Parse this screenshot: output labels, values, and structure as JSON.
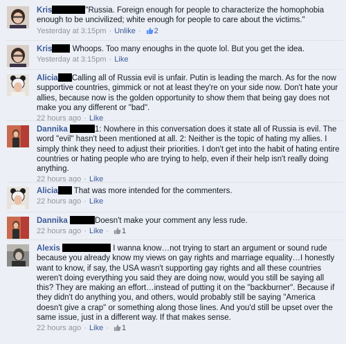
{
  "comments": [
    {
      "name": "Kris",
      "text": "\"Russia. Foreign enough for people to characterize the homophobia enough to be uncivilized; white enough for people to care about the victims.\"",
      "time": "Yesterday at 3:15pm",
      "action": "Unlike",
      "likes": "2",
      "avatar": "kris-avatar-icon"
    },
    {
      "name": "Kris",
      "text": "Whoops. Too many enoughs in the quote lol. But you get the idea.",
      "time": "Yesterday at 3:15pm",
      "action": "Like",
      "likes": "",
      "avatar": "kris-avatar-icon"
    },
    {
      "name": "Alicia",
      "text": "Calling all of Russia evil is unfair. Putin is leading the march. As for the now supportive countries, gimmick or not at least they're on your side now. Don't hate your allies, because now is the golden opportunity to show them that being gay does not make you any different or \"bad\".",
      "time": "22 hours ago",
      "action": "Like",
      "likes": "",
      "avatar": "alicia-avatar-icon"
    },
    {
      "name": "Dannika",
      "text": "1: Nowhere in this conversation does it state all of Russia is evil. The word \"evil\" hasn't been mentioned at all. 2: Neither is the topic of hating my allies. I simply think they need to adjust their priorities. I don't get into the habit of hating entire countries or hating people who are trying to help, even if their help isn't really doing anything.",
      "time": "22 hours ago",
      "action": "Like",
      "likes": "",
      "avatar": "dannika-avatar-icon"
    },
    {
      "name": "Alicia",
      "text": "That was more intended for the commenters.",
      "time": "22 hours ago",
      "action": "Like",
      "likes": "",
      "avatar": "alicia-avatar-icon"
    },
    {
      "name": "Dannika",
      "text": "Doesn't make your comment any less rude.",
      "time": "22 hours ago",
      "action": "Like",
      "likes": "1",
      "avatar": "dannika-avatar-icon"
    },
    {
      "name": "Alexis",
      "text": "I wanna know…not trying to start an argument or sound rude because you already know my views on gay rights and marriage equality…I honestly want to know, if say, the USA wasn't supporting gay rights and all these countries weren't doing everything you said they are doing now, would you still be saying all this? They are making an effort…instead of putting it on the \"backburner\". Because if they didn't do anything you, and others, would probably still be saying \"America doesn't give a crap\" or something along those lines. And you'd still be upset over the same issue, just in a different way. If that makes sense.",
      "time": "22 hours ago",
      "action": "Like",
      "likes": "1",
      "avatar": "alexis-avatar-icon"
    }
  ],
  "colors": {
    "link": "#3b5998",
    "meta": "#90949c",
    "background": "#eceff5",
    "thumb_active": "#5890ff",
    "thumb_grey": "#90949c"
  }
}
